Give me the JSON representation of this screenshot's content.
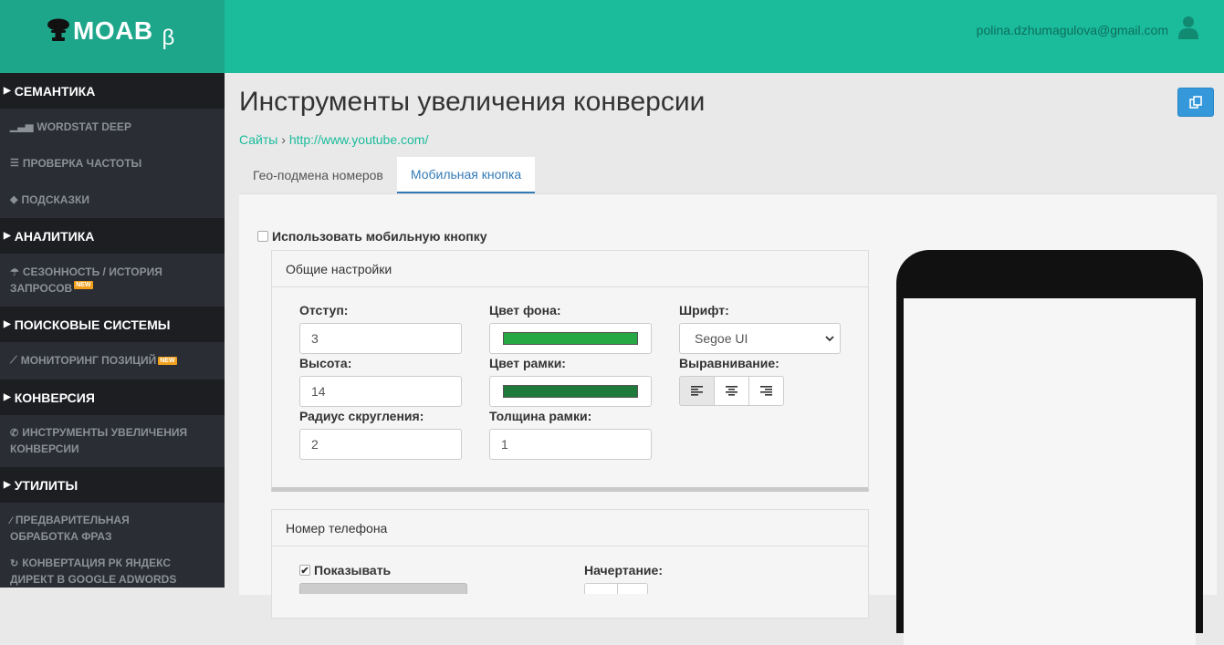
{
  "brand": {
    "name": "MOAB",
    "beta": "β"
  },
  "user": {
    "email": "polina.dzhumagulova@gmail.com"
  },
  "sidebar": {
    "sections": [
      {
        "title": "СЕМАНТИКА",
        "items": [
          {
            "label": "WORDSTAT DEEP",
            "icon": "bar-chart-icon"
          },
          {
            "label": "ПРОВЕРКА ЧАСТОТЫ",
            "icon": "list-icon"
          },
          {
            "label": "ПОДСКАЗКИ",
            "icon": "tags-icon"
          }
        ]
      },
      {
        "title": "АНАЛИТИКА",
        "items": [
          {
            "label_line1": "СЕЗОННОСТЬ / ИСТОРИЯ",
            "label_line2": "ЗАПРОСОВ",
            "badge": "NEW",
            "icon": "umbrella-icon"
          }
        ]
      },
      {
        "title": "ПОИСКОВЫЕ СИСТЕМЫ",
        "items": [
          {
            "label": "МОНИТОРИНГ ПОЗИЦИЙ",
            "badge": "NEW",
            "icon": "line-chart-icon"
          }
        ]
      },
      {
        "title": "КОНВЕРСИЯ",
        "items": [
          {
            "label_line1": "ИНСТРУМЕНТЫ УВЕЛИЧЕНИЯ",
            "label_line2": "КОНВЕРСИИ",
            "icon": "phone-icon"
          }
        ]
      },
      {
        "title": "УТИЛИТЫ",
        "items": [
          {
            "label_line1": "ПРЕДВАРИТЕЛЬНАЯ",
            "label_line2": "ОБРАБОТКА ФРАЗ",
            "icon": "magic-wand-icon"
          },
          {
            "label_line1": "КОНВЕРТАЦИЯ РК ЯНДЕКС",
            "label_line2": "ДИРЕКТ В GOOGLE ADWORDS",
            "icon": "sync-icon"
          }
        ]
      }
    ]
  },
  "page": {
    "title": "Инструменты увеличения конверсии",
    "breadcrumb": {
      "root": "Сайты",
      "sep": "›",
      "current": "http://www.youtube.com/"
    },
    "tabs": [
      "Гео-подмена номеров",
      "Мобильная кнопка"
    ],
    "active_tab": 1
  },
  "form": {
    "use_mobile_label": "Использовать мобильную кнопку",
    "general": {
      "title": "Общие настройки",
      "indent_label": "Отступ:",
      "indent_value": "3",
      "height_label": "Высота:",
      "height_value": "14",
      "radius_label": "Радиус скругления:",
      "radius_value": "2",
      "bg_color_label": "Цвет фона:",
      "bg_color": "#28a745",
      "border_color_label": "Цвет рамки:",
      "border_color": "#1d7a3b",
      "border_width_label": "Толщина рамки:",
      "border_width_value": "1",
      "font_label": "Шрифт:",
      "font_value": "Segoe UI",
      "align_label": "Выравнивание:"
    },
    "phone": {
      "title": "Номер телефона",
      "show_label": "Показывать",
      "style_label": "Начертание:"
    }
  }
}
